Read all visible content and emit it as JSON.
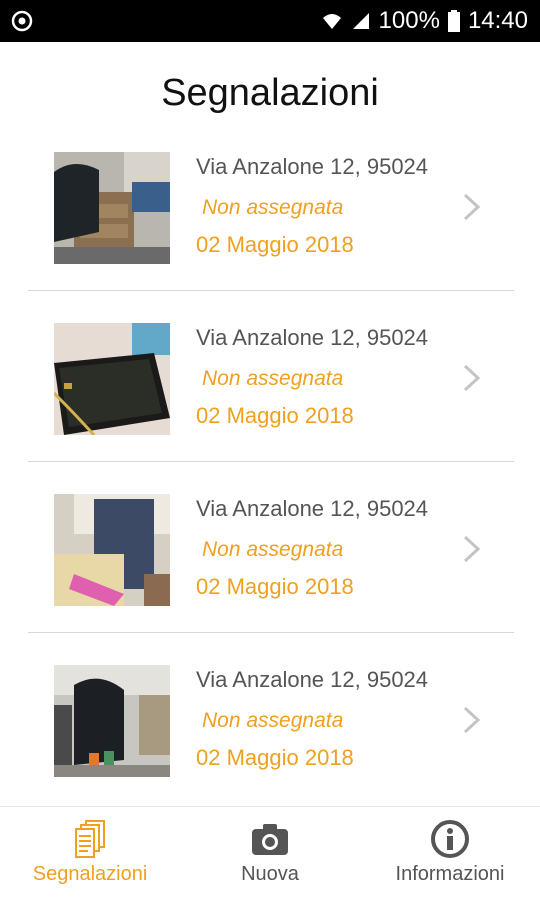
{
  "status_bar": {
    "battery": "100%",
    "time": "14:40"
  },
  "page": {
    "title": "Segnalazioni"
  },
  "reports": [
    {
      "address": "Via Anzalone 12, 95024",
      "status": "Non assegnata",
      "date": "02 Maggio 2018",
      "thumb": "desk-chair-bag"
    },
    {
      "address": "Via Anzalone 12, 95024",
      "status": "Non assegnata",
      "date": "02 Maggio 2018",
      "thumb": "tablet-on-desk"
    },
    {
      "address": "Via Anzalone 12, 95024",
      "status": "Non assegnata",
      "date": "02 Maggio 2018",
      "thumb": "person-at-desk"
    },
    {
      "address": "Via Anzalone 12, 95024",
      "status": "Non assegnata",
      "date": "02 Maggio 2018",
      "thumb": "bag-and-cups"
    }
  ],
  "tabs": [
    {
      "label": "Segnalazioni",
      "icon": "documents-icon",
      "active": true
    },
    {
      "label": "Nuova",
      "icon": "camera-icon",
      "active": false
    },
    {
      "label": "Informazioni",
      "icon": "info-icon",
      "active": false
    }
  ],
  "colors": {
    "accent": "#f0a020",
    "text_muted": "#555555",
    "icon_gray": "#555555",
    "statusbar": "#000000"
  }
}
